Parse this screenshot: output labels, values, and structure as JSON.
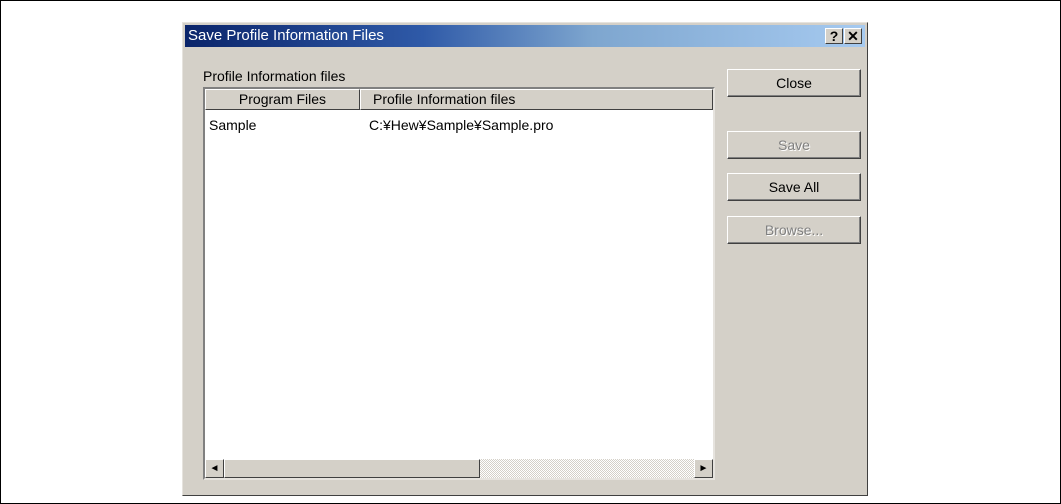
{
  "dialog": {
    "title": "Save Profile Information Files",
    "help_label": "?",
    "close_label": "✕"
  },
  "group": {
    "label": "Profile Information files"
  },
  "list": {
    "columns": [
      "Program Files",
      "Profile Information files"
    ],
    "rows": [
      [
        "Sample",
        "C:¥Hew¥Sample¥Sample.pro"
      ]
    ],
    "scroll_left": "◄",
    "scroll_right": "►"
  },
  "buttons": {
    "close": "Close",
    "save": "Save",
    "save_all": "Save All",
    "browse": "Browse..."
  }
}
